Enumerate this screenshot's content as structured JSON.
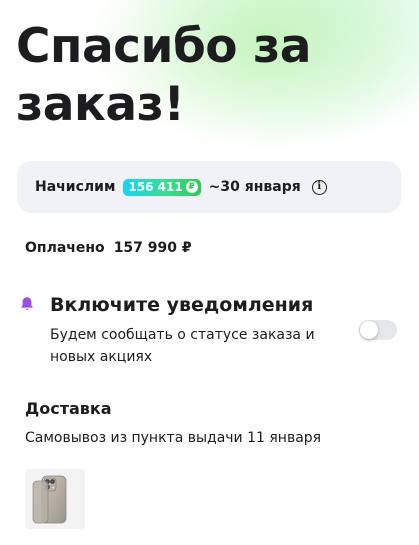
{
  "header": {
    "title": "Спасибо за заказ!"
  },
  "cashback": {
    "prefix": "Начислим",
    "points": "156 411",
    "date": "~30 января",
    "badge_colors": [
      "#17d4f5",
      "#3bdc91",
      "#2fc85a"
    ]
  },
  "payment": {
    "label": "Оплачено",
    "amount": "157 990 ₽"
  },
  "notifications": {
    "title": "Включите уведомления",
    "description": "Будем сообщать о статусе заказа и новых акциях",
    "enabled": false,
    "icon": "bell-icon",
    "icon_color": "#9b4fdc"
  },
  "delivery": {
    "title": "Доставка",
    "text": "Самовывоз из пункта выдачи 11 января"
  },
  "order": {
    "items": [
      {
        "image": "iphone-thumbnail"
      }
    ]
  }
}
